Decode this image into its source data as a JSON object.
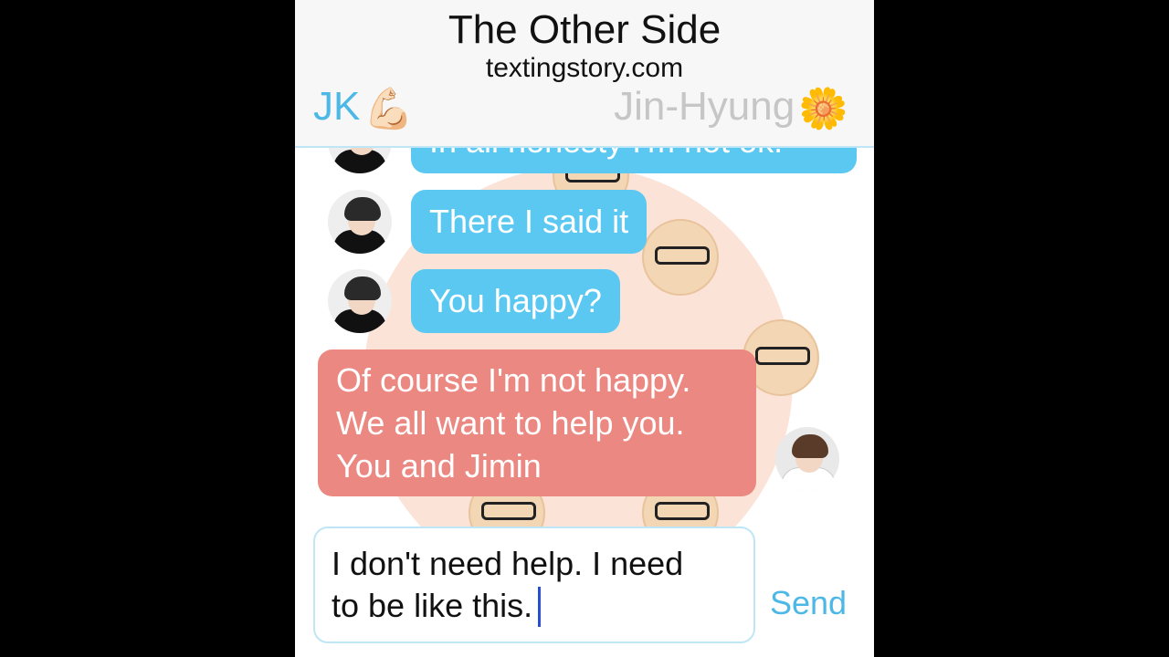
{
  "app": {
    "title": "The Other Side",
    "site": "textingstory.com"
  },
  "contacts": {
    "left_name": "JK",
    "left_emoji": "💪🏻",
    "right_name": "Jin-Hyung",
    "right_emoji": "🌼"
  },
  "colors": {
    "blue_bubble": "#5bc8f2",
    "red_bubble": "#ec8882",
    "accent": "#4db8e6"
  },
  "messages": [
    {
      "sender": "JK",
      "side": "left",
      "text": "In all honesty I'm not ok."
    },
    {
      "sender": "JK",
      "side": "left",
      "text": "There I said it"
    },
    {
      "sender": "JK",
      "side": "left",
      "text": "You happy?"
    },
    {
      "sender": "Jin-Hyung",
      "side": "right",
      "lines": [
        "Of course I'm not happy.",
        "We all want to help you.",
        "You and Jimin"
      ]
    }
  ],
  "composer": {
    "text_lines": [
      "I don't need help. I need",
      "to be like this."
    ],
    "send_label": "Send"
  }
}
